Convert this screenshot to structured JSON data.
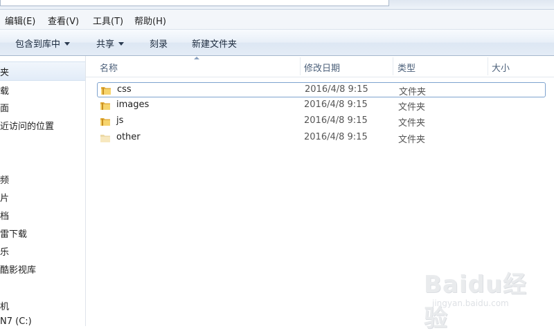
{
  "menubar": {
    "items": [
      {
        "label": "编辑(E)"
      },
      {
        "label": "查看(V)"
      },
      {
        "label": "工具(T)"
      },
      {
        "label": "帮助(H)"
      }
    ]
  },
  "commandbar": {
    "include_library": "包含到库中",
    "share": "共享",
    "burn": "刻录",
    "new_folder": "新建文件夹"
  },
  "navpane": {
    "items": [
      {
        "label": "夹"
      },
      {
        "label": "载"
      },
      {
        "label": "面"
      },
      {
        "label": "近访问的位置"
      },
      {
        "label": "频"
      },
      {
        "label": "片"
      },
      {
        "label": "档"
      },
      {
        "label": "雷下载"
      },
      {
        "label": "乐"
      },
      {
        "label": "酷影视库"
      },
      {
        "label": "机"
      },
      {
        "label": "N7 (C:)"
      }
    ]
  },
  "columns": {
    "name": "名称",
    "modified": "修改日期",
    "type": "类型",
    "size": "大小"
  },
  "files": [
    {
      "name": "css",
      "modified": "2016/4/8 9:15",
      "type": "文件夹"
    },
    {
      "name": "images",
      "modified": "2016/4/8 9:15",
      "type": "文件夹"
    },
    {
      "name": "js",
      "modified": "2016/4/8 9:15",
      "type": "文件夹"
    },
    {
      "name": "other",
      "modified": "2016/4/8 9:15",
      "type": "文件夹"
    }
  ],
  "watermark": {
    "main": "Baidu经验",
    "sub": "jingyan.baidu.com"
  },
  "colors": {
    "selection_border": "#7da2ce",
    "folder_yellow": "#f2c85a"
  }
}
